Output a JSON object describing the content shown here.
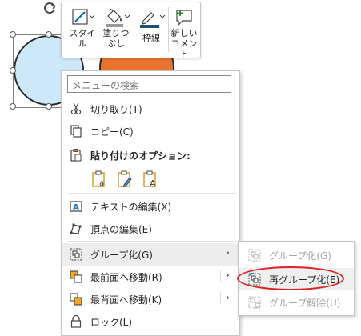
{
  "mini_toolbar": {
    "style": {
      "line1": "スタイ",
      "line2": "ル"
    },
    "fill": {
      "line1": "塗りつ",
      "line2": "ぶし"
    },
    "outline": {
      "line1": "枠線"
    },
    "new_comment": {
      "line1": "新しい",
      "line2": "コメント"
    }
  },
  "menu": {
    "search_placeholder": "メニューの検索",
    "cut": "切り取り(T)",
    "copy": "コピー(C)",
    "paste_options": "貼り付けのオプション:",
    "edit_text": "テキストの編集(X)",
    "edit_points": "頂点の編集(E)",
    "group": "グループ化(G)",
    "bring_to_front": "最前面へ移動(R)",
    "send_to_back": "最背面へ移動(K)",
    "lock": "ロック(L)"
  },
  "submenu": {
    "group": "グループ化(G)",
    "regroup": "再グループ化(E)",
    "ungroup": "グループ解除(U)"
  },
  "colors": {
    "circle_blue": "#cce8f9",
    "circle_orange": "#e9742f",
    "annotation_red": "#e02020",
    "accent": "#0f6cbd"
  }
}
